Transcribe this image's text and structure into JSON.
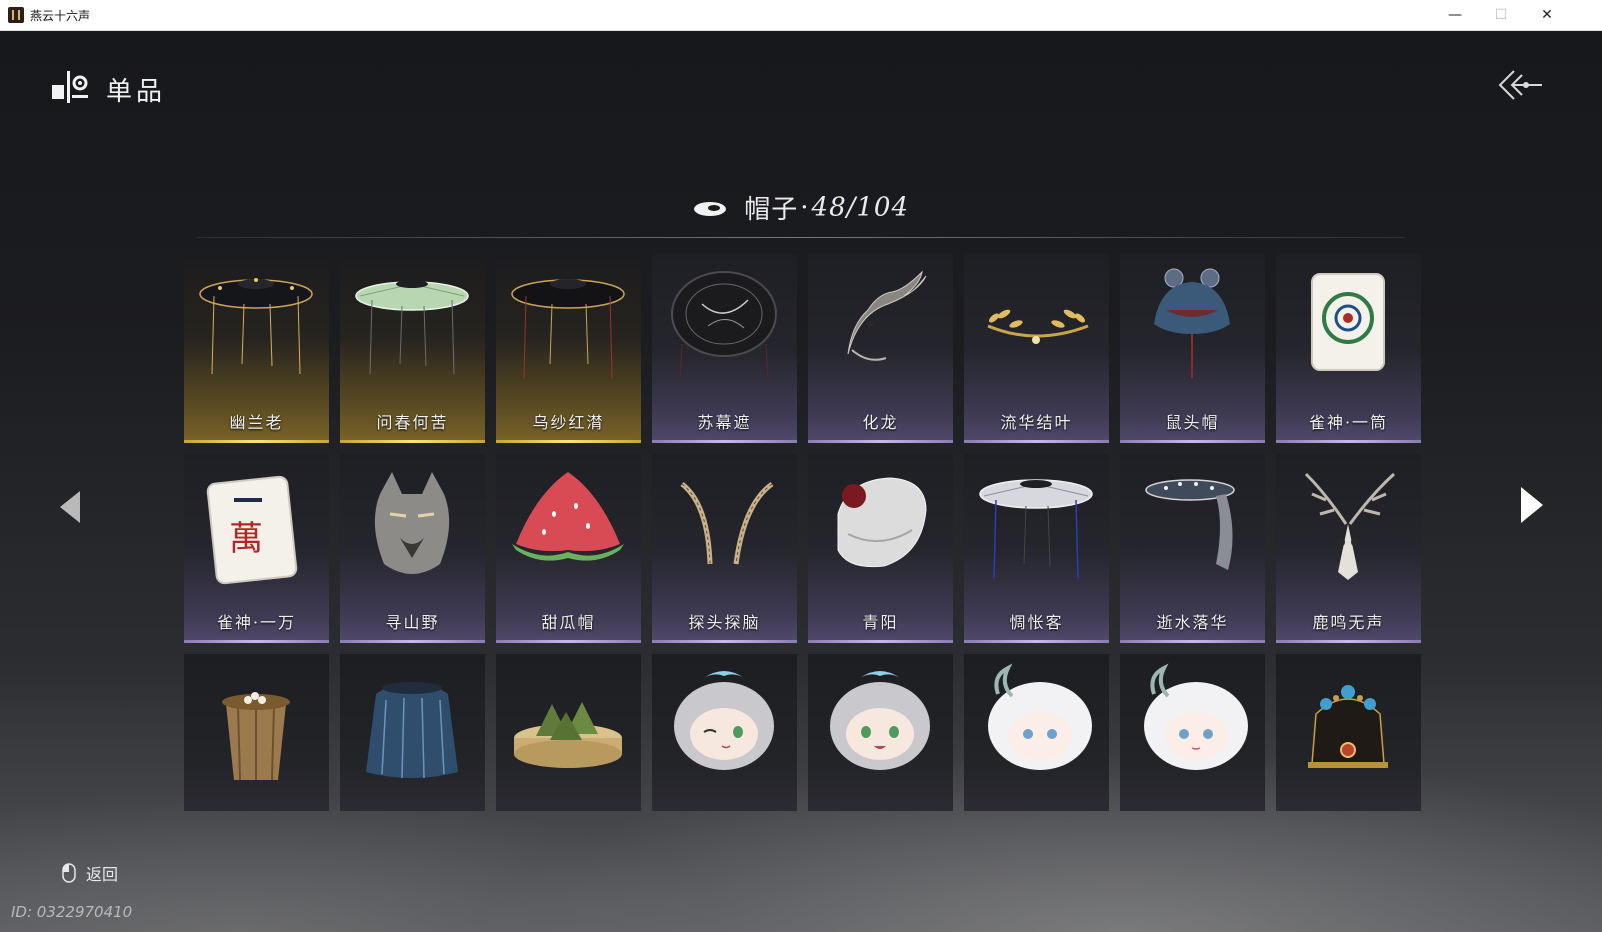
{
  "window": {
    "title": "燕云十六声",
    "minimize": "—",
    "maximize": "☐",
    "close": "✕"
  },
  "header": {
    "title": "单品"
  },
  "category": {
    "name": "帽子",
    "separator": "·",
    "count": "48/104"
  },
  "items": [
    {
      "name": "幽兰老",
      "rarity": "gold",
      "icon": "black-bamboo-hat"
    },
    {
      "name": "问春何苦",
      "rarity": "gold",
      "icon": "green-bamboo-hat"
    },
    {
      "name": "乌纱红潸",
      "rarity": "gold",
      "icon": "black-veil-hat"
    },
    {
      "name": "苏幕遮",
      "rarity": "purple",
      "icon": "dark-round-hat"
    },
    {
      "name": "化龙",
      "rarity": "purple",
      "icon": "dragon-headpiece"
    },
    {
      "name": "流华结叶",
      "rarity": "purple",
      "icon": "gold-leaf-circlet"
    },
    {
      "name": "鼠头帽",
      "rarity": "purple",
      "icon": "mouse-hood"
    },
    {
      "name": "雀神·一筒",
      "rarity": "purple",
      "icon": "mahjong-one-circle"
    },
    {
      "name": "雀神·一万",
      "rarity": "purple",
      "icon": "mahjong-one-wan"
    },
    {
      "name": "寻山野",
      "rarity": "purple",
      "icon": "wolf-head"
    },
    {
      "name": "甜瓜帽",
      "rarity": "purple",
      "icon": "watermelon-hat"
    },
    {
      "name": "探头探脑",
      "rarity": "purple",
      "icon": "feather-antennae"
    },
    {
      "name": "青阳",
      "rarity": "purple",
      "icon": "white-bucket-hat"
    },
    {
      "name": "惆怅客",
      "rarity": "purple",
      "icon": "white-veil-hat"
    },
    {
      "name": "逝水落华",
      "rarity": "purple",
      "icon": "jeweled-veil"
    },
    {
      "name": "鹿鸣无声",
      "rarity": "purple",
      "icon": "deer-skull"
    },
    {
      "name": "",
      "rarity": "plain",
      "icon": "nest-bucket"
    },
    {
      "name": "",
      "rarity": "plain",
      "icon": "blue-veil-hood"
    },
    {
      "name": "",
      "rarity": "plain",
      "icon": "zongzi-steamer"
    },
    {
      "name": "",
      "rarity": "plain",
      "icon": "chibi-grey-wink"
    },
    {
      "name": "",
      "rarity": "plain",
      "icon": "chibi-grey-smile"
    },
    {
      "name": "",
      "rarity": "plain",
      "icon": "chibi-white-hair"
    },
    {
      "name": "",
      "rarity": "plain",
      "icon": "chibi-white-hair-2"
    },
    {
      "name": "",
      "rarity": "plain",
      "icon": "phoenix-crown"
    }
  ],
  "footer": {
    "back_label": "返回",
    "player_id": "ID: 0322970410"
  },
  "colors": {
    "gold_rarity": "#ffe083",
    "purple_rarity": "#c7b8ef"
  }
}
